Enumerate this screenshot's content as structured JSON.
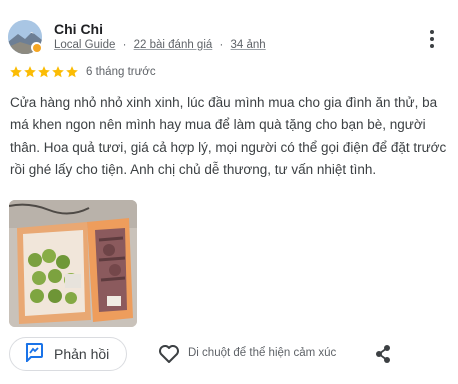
{
  "reviewer": {
    "name": "Chi Chi",
    "role": "Local Guide",
    "reviews": "22 bài đánh giá",
    "photos": "34 ảnh",
    "separator": "·"
  },
  "rating": {
    "stars": 5,
    "max": 5,
    "color": "#fbbc04"
  },
  "date": "6 tháng trước",
  "review_text": "Cửa hàng nhỏ nhỏ xinh xinh, lúc đầu mình mua cho gia đình ăn thử, ba má khen ngon nên mình hay mua để làm quà tặng cho bạn bè, người thân. Hoa quả tươi, giá cả hợp lý, mọi người có thể gọi điện để đặt trước rồi ghé lấy cho tiện. Anh chị chủ dễ thương, tư vấn nhiệt tình.",
  "actions": {
    "reply_label": "Phản hồi",
    "react_hint": "Di chuột để thể hiện cảm xúc",
    "accent": "#1a73e8"
  },
  "icons": {
    "more": "more-vertical-icon",
    "reply": "reply-icon",
    "like": "heart-icon",
    "share": "share-icon"
  }
}
